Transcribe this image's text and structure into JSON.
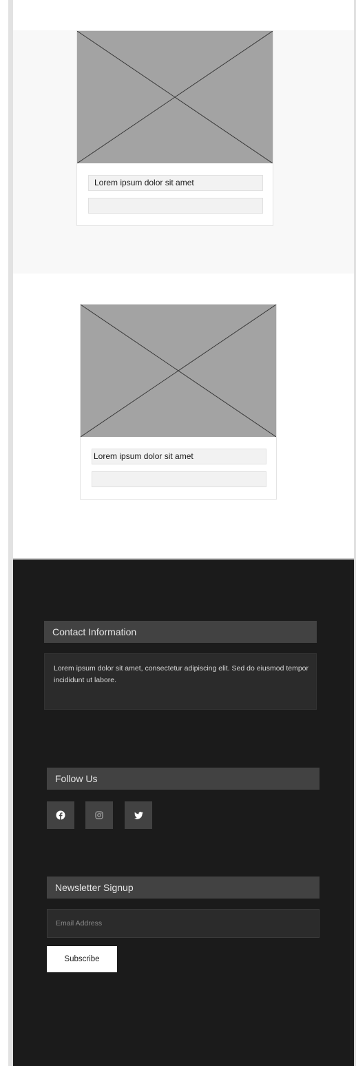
{
  "cards": [
    {
      "caption": "Lorem ipsum dolor sit amet",
      "secondary": ""
    },
    {
      "caption": "Lorem ipsum dolor sit amet",
      "secondary": ""
    }
  ],
  "footer": {
    "contact": {
      "heading": "Contact Information",
      "text": "Lorem ipsum dolor sit amet, consectetur adipiscing elit. Sed do eiusmod tempor incididunt ut labore."
    },
    "follow": {
      "heading": "Follow Us",
      "icons": [
        "facebook-icon",
        "instagram-icon",
        "twitter-icon"
      ]
    },
    "newsletter": {
      "heading": "Newsletter Signup",
      "email_placeholder": "Email Address",
      "subscribe_label": "Subscribe"
    }
  },
  "colors": {
    "footer_bg": "#1b1b1b",
    "heading_bg": "#424242",
    "placeholder_gray": "#a3a3a3"
  }
}
